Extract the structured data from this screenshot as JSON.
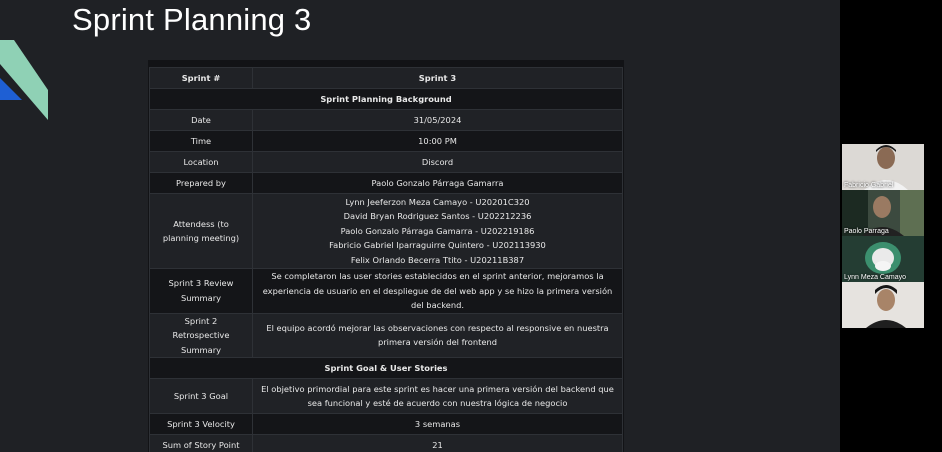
{
  "slide": {
    "title": "Sprint Planning 3"
  },
  "table": {
    "sprint_label": "Sprint #",
    "sprint_value": "Sprint 3",
    "background_header": "Sprint Planning Background",
    "date_label": "Date",
    "date_value": "31/05/2024",
    "time_label": "Time",
    "time_value": "10:00 PM",
    "location_label": "Location",
    "location_value": "Discord",
    "prepared_label": "Prepared by",
    "prepared_value": "Paolo Gonzalo Párraga Gamarra",
    "attendees_label": "Attendess (to planning meeting)",
    "attendees": [
      "Lynn Jeeferzon Meza Camayo - U20201C320",
      "David Bryan Rodriguez Santos - U202212236",
      "Paolo Gonzalo Párraga Gamarra - U202219186",
      "Fabricio Gabriel Iparraguirre Quintero - U202113930",
      "Felix Orlando Becerra Ttito - U20211B387"
    ],
    "review_label": "Sprint 3 Review Summary",
    "review_value": "Se completaron las user stories establecidos en el sprint anterior, mejoramos la experiencia de usuario en el despliegue de del web app y se hizo la primera versión del backend.",
    "retro_label": "Sprint 2 Retrospective Summary",
    "retro_value": "El equipo acordó mejorar las observaciones con respecto al responsive en nuestra primera versión del frontend",
    "goal_header": "Sprint Goal & User Stories",
    "goal_label": "Sprint 3 Goal",
    "goal_value": "El objetivo primordial para este sprint es hacer una primera versión del backend que sea funcional y esté de acuerdo con nuestra lógica de negocio",
    "velocity_label": "Sprint 3 Velocity",
    "velocity_value": "3 semanas",
    "points_label": "Sum of Story Point",
    "points_value": "21"
  },
  "participants": [
    {
      "name": "Fabricio Gabriel"
    },
    {
      "name": "Paolo Parraga"
    },
    {
      "name": "Lynn Meza Camayo"
    },
    {
      "name": ""
    }
  ],
  "colors": {
    "slide_bg": "#1f2125",
    "accent_teal": "#8fd1b5",
    "accent_blue": "#1e5fd4"
  }
}
